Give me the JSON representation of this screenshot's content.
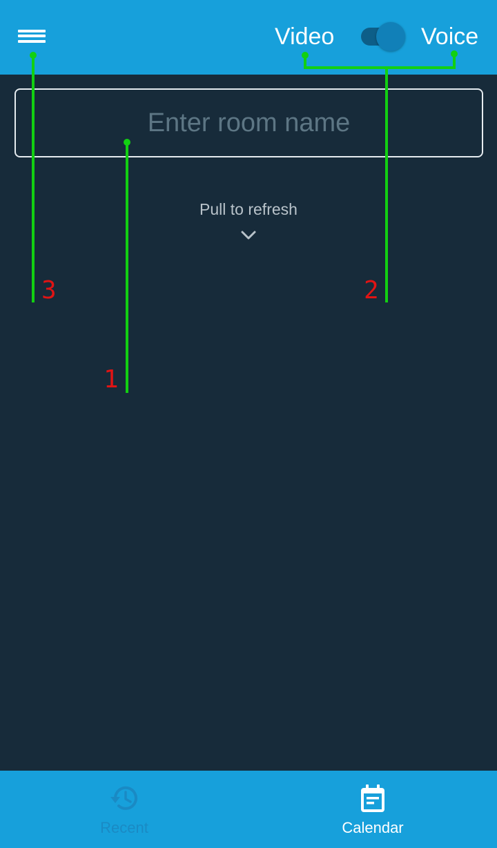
{
  "header": {
    "menu_icon": "hamburger-menu-icon",
    "mode_left_label": "Video",
    "mode_right_label": "Voice",
    "toggle_state": "voice"
  },
  "room": {
    "value": "",
    "placeholder": "Enter room name"
  },
  "pull_to_refresh": {
    "label": "Pull to refresh",
    "icon": "chevron-down-icon"
  },
  "annotations": [
    {
      "number": "1"
    },
    {
      "number": "2"
    },
    {
      "number": "3"
    }
  ],
  "bottom_nav": {
    "tabs": [
      {
        "label": "Recent",
        "icon": "history-icon",
        "active": false
      },
      {
        "label": "Calendar",
        "icon": "calendar-icon",
        "active": true
      }
    ]
  },
  "colors": {
    "header_bg": "#17a0db",
    "body_bg": "#172b3a",
    "annotation_line": "#12d012",
    "annotation_number": "#e01414"
  }
}
